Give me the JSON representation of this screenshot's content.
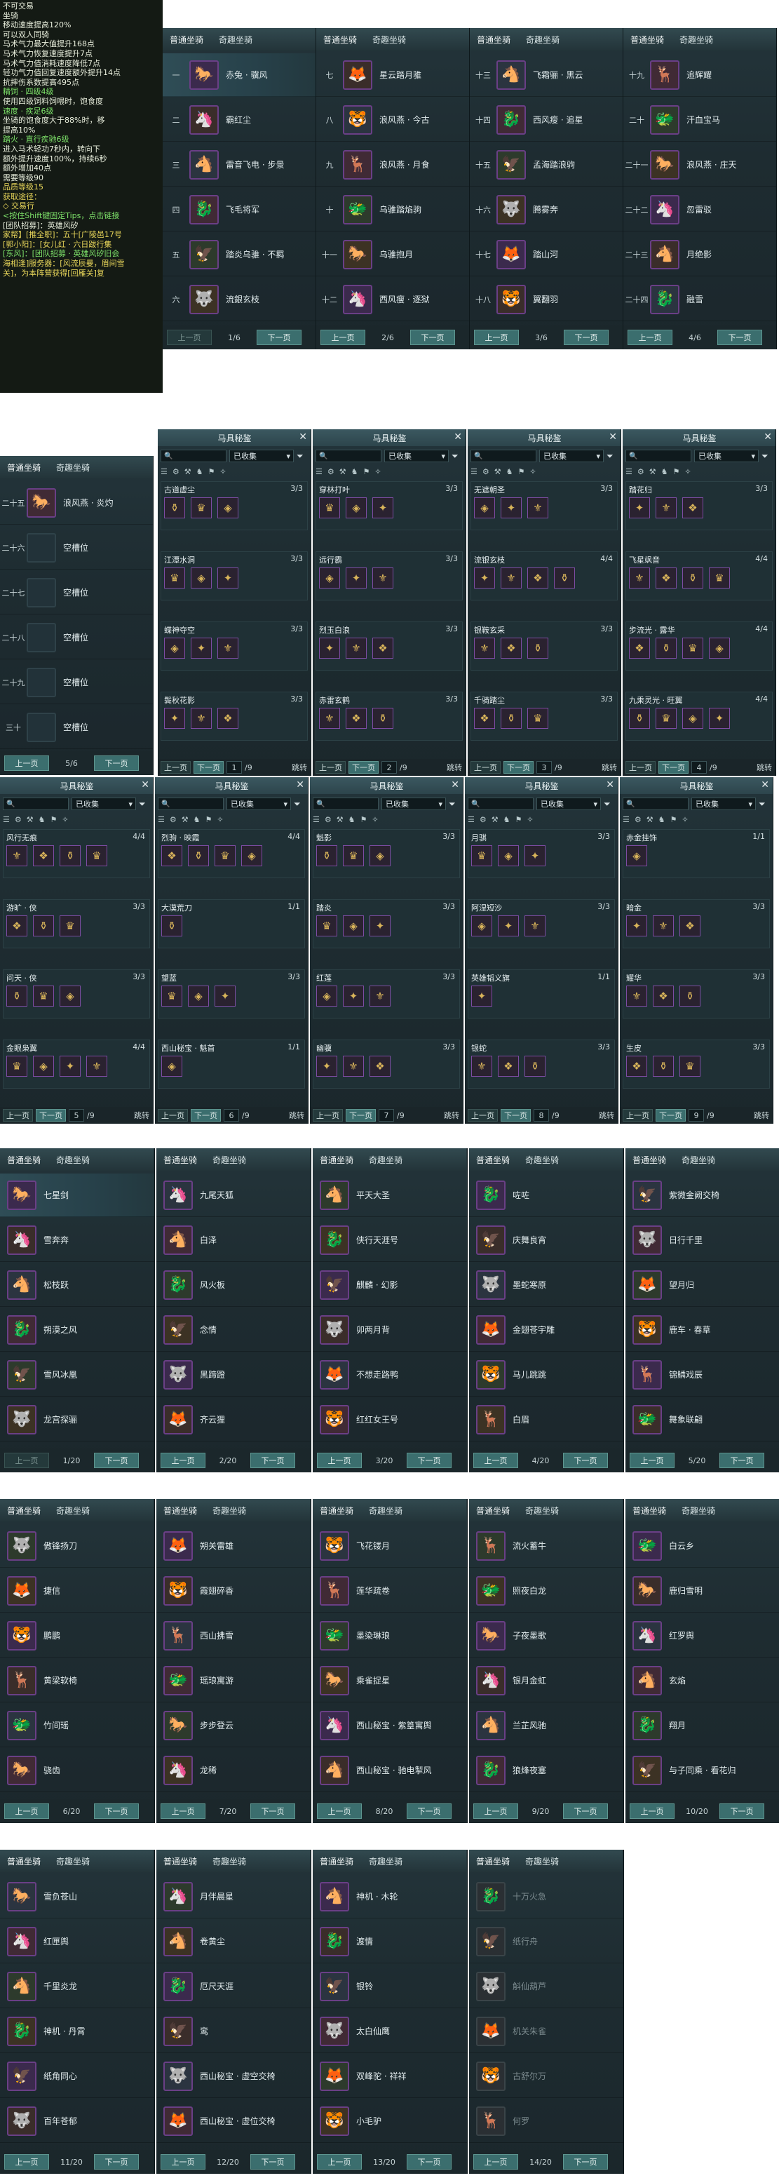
{
  "tooltip": {
    "lines": [
      {
        "t": "不可交易",
        "c": "#e8eedc"
      },
      {
        "t": "坐骑",
        "c": "#e8eedc"
      },
      {
        "t": "移动速度提高120%",
        "c": "#e8eedc"
      },
      {
        "t": "可以双人同骑",
        "c": "#e8eedc"
      },
      {
        "t": "马术气力最大值提升168点",
        "c": "#e8eedc"
      },
      {
        "t": "马术气力恢复速度提升7点",
        "c": "#e8eedc"
      },
      {
        "t": "马术气力值消耗速度降低7点",
        "c": "#e8eedc"
      },
      {
        "t": "轻功气力值回复速度额外提升14点",
        "c": "#e8eedc"
      },
      {
        "t": "抗摔伤系数提高495点",
        "c": "#e8eedc"
      },
      {
        "t": "精饲 · 四级4级",
        "c": "#7ee36a"
      },
      {
        "t": "使用四级饲料饲喂时，饱食度",
        "c": "#e8eedc"
      },
      {
        "t": "速度 · 疾足6级",
        "c": "#7ee36a"
      },
      {
        "t": "坐骑的饱食度大于88%时，移",
        "c": "#e8eedc"
      },
      {
        "t": "提高10%",
        "c": "#e8eedc"
      },
      {
        "t": "踏火 · 直行疾驰6级",
        "c": "#7ee36a"
      },
      {
        "t": "进入马术轻功7秒内，转向下",
        "c": "#e8eedc"
      },
      {
        "t": "额外提升速度100%，持续6秒",
        "c": "#e8eedc"
      },
      {
        "t": "额外增加40点",
        "c": "#e8eedc"
      },
      {
        "t": "需要等级90",
        "c": "#e8eedc"
      },
      {
        "t": "品质等级15",
        "c": "#e8d65a"
      },
      {
        "t": "获取途径：",
        "c": "#e8d65a"
      },
      {
        "t": "◇ 交易行",
        "c": "#e8d65a"
      },
      {
        "t": "",
        "c": "#e8eedc"
      },
      {
        "t": "<按住Shift键固定Tips，点击链接",
        "c": "#7ee36a"
      },
      {
        "t": "[团队招募]：英雄风矽",
        "c": "#e8eedc"
      },
      {
        "t": "家帮】[推全职]：五十[广陵邑17号",
        "c": "#e8d65a"
      },
      {
        "t": "[郭小阳]：[女儿红 · 六日跋行集",
        "c": "#e8d65a"
      },
      {
        "t": "[东风]：[团队招募 · 英雄风矽旧会",
        "c": "#7ee36a"
      },
      {
        "t": "",
        "c": "#e8eedc"
      },
      {
        "t": "海相逢]服务器：[风流辰曼，眉间雪",
        "c": "#e8d65a"
      },
      {
        "t": "关]，为本阵营获得[回雁关]复",
        "c": "#e8d65a"
      }
    ]
  },
  "tabs": {
    "normal": "普通坐骑",
    "odd": "奇趣坐骑"
  },
  "pager": {
    "prev": "上一页",
    "next": "下一页",
    "jump": "跳转"
  },
  "mount_pages_top": [
    {
      "page": "1/6",
      "rows": [
        {
          "n": "一",
          "name": "赤兔 · 骥风"
        },
        {
          "n": "二",
          "name": "霸红尘"
        },
        {
          "n": "三",
          "name": "雷音飞电 · 步景"
        },
        {
          "n": "四",
          "name": "飞毛将军"
        },
        {
          "n": "五",
          "name": "踏炎乌骓 · 不羁"
        },
        {
          "n": "六",
          "name": "流銀玄枝"
        }
      ]
    },
    {
      "page": "2/6",
      "rows": [
        {
          "n": "七",
          "name": "星云踏月骓"
        },
        {
          "n": "八",
          "name": "浪风燕 · 今古"
        },
        {
          "n": "九",
          "name": "浪风燕 · 月食"
        },
        {
          "n": "十",
          "name": "乌骓踏焰驹"
        },
        {
          "n": "十一",
          "name": "乌骓抱月"
        },
        {
          "n": "十二",
          "name": "西风瘦 · 逐狱"
        }
      ]
    },
    {
      "page": "3/6",
      "rows": [
        {
          "n": "十三",
          "name": "飞霜骊 · 黑云"
        },
        {
          "n": "十四",
          "name": "西风瘦 · 追星"
        },
        {
          "n": "十五",
          "name": "孟海踏浪驹"
        },
        {
          "n": "十六",
          "name": "腾雾奔"
        },
        {
          "n": "十七",
          "name": "踏山河"
        },
        {
          "n": "十八",
          "name": "翼翻羽"
        }
      ]
    },
    {
      "page": "4/6",
      "rows": [
        {
          "n": "十九",
          "name": "追辉耀"
        },
        {
          "n": "二十",
          "name": "汗血宝马"
        },
        {
          "n": "二十一",
          "name": "浪风燕 · 庄天"
        },
        {
          "n": "二十二",
          "name": "忽雷驳"
        },
        {
          "n": "二十三",
          "name": "月绝影"
        },
        {
          "n": "二十四",
          "name": "融雪"
        }
      ]
    }
  ],
  "mount_page5": {
    "page": "5/6",
    "rows": [
      {
        "n": "二十五",
        "name": "浪风燕 · 炎灼"
      },
      {
        "n": "二十六",
        "name": "空槽位"
      },
      {
        "n": "二十七",
        "name": "空槽位"
      },
      {
        "n": "二十八",
        "name": "空槽位"
      },
      {
        "n": "二十九",
        "name": "空槽位"
      },
      {
        "n": "三十",
        "name": "空槽位"
      }
    ]
  },
  "harness": {
    "title": "马具秘鉴",
    "filter": "已收集",
    "pages": [
      {
        "pg": "1",
        "of": "/9",
        "sets": [
          {
            "name": "古道虚尘",
            "count": "3/3"
          },
          {
            "name": "江潭水洞",
            "count": "3/3"
          },
          {
            "name": "蝶神夺空",
            "count": "3/3"
          },
          {
            "name": "鬓秋花影",
            "count": "3/3"
          }
        ]
      },
      {
        "pg": "2",
        "of": "/9",
        "sets": [
          {
            "name": "穿林打叶",
            "count": "3/3"
          },
          {
            "name": "远行霸",
            "count": "3/3"
          },
          {
            "name": "烈玉白浪",
            "count": "3/3"
          },
          {
            "name": "赤雷玄鹤",
            "count": "3/3"
          }
        ]
      },
      {
        "pg": "3",
        "of": "/9",
        "sets": [
          {
            "name": "无遮朝圣",
            "count": "3/3"
          },
          {
            "name": "流银玄枝",
            "count": "4/4"
          },
          {
            "name": "银鞍玄采",
            "count": "3/3"
          },
          {
            "name": "千骑踏尘",
            "count": "3/3"
          }
        ]
      },
      {
        "pg": "4",
        "of": "/9",
        "sets": [
          {
            "name": "踏花归",
            "count": "3/3"
          },
          {
            "name": "飞星飒音",
            "count": "4/4"
          },
          {
            "name": "步流光 · 露华",
            "count": "4/4"
          },
          {
            "name": "九乘灵光 · 旺翼",
            "count": "4/4"
          }
        ]
      },
      {
        "pg": "5",
        "of": "/9",
        "sets": [
          {
            "name": "风行无痕",
            "count": "4/4"
          },
          {
            "name": "游旷 · 侠",
            "count": "3/3"
          },
          {
            "name": "问天 · 侠",
            "count": "3/3"
          },
          {
            "name": "金眼枭翼",
            "count": "4/4"
          }
        ]
      },
      {
        "pg": "6",
        "of": "/9",
        "sets": [
          {
            "name": "烈驹 · 映霞",
            "count": "4/4"
          },
          {
            "name": "大漠荒刀",
            "count": "1/1"
          },
          {
            "name": "望蓝",
            "count": "3/3"
          },
          {
            "name": "西山秘宝 · 魁首",
            "count": "1/1"
          }
        ]
      },
      {
        "pg": "7",
        "of": "/9",
        "sets": [
          {
            "name": "魁影",
            "count": "3/3"
          },
          {
            "name": "踏炎",
            "count": "3/3"
          },
          {
            "name": "红莲",
            "count": "3/3"
          },
          {
            "name": "幽骥",
            "count": "3/3"
          }
        ]
      },
      {
        "pg": "8",
        "of": "/9",
        "sets": [
          {
            "name": "月骐",
            "count": "3/3"
          },
          {
            "name": "阿涅短沙",
            "count": "3/3"
          },
          {
            "name": "英雄韬义旗",
            "count": "1/1"
          },
          {
            "name": "银蛇",
            "count": "3/3"
          }
        ]
      },
      {
        "pg": "9",
        "of": "/9",
        "sets": [
          {
            "name": "赤金挂饰",
            "count": "1/1"
          },
          {
            "name": "暗金",
            "count": "3/3"
          },
          {
            "name": "耀华",
            "count": "3/3"
          },
          {
            "name": "生皮",
            "count": "3/3"
          }
        ]
      }
    ]
  },
  "odd_pages": [
    {
      "page": "1/20",
      "items": [
        "七星剑",
        "雪奔奔",
        "松枝跃",
        "朔漠之风",
        "雪风冰凰",
        "龙宫探骊"
      ]
    },
    {
      "page": "2/20",
      "items": [
        "九尾天狐",
        "白泽",
        "风火板",
        "念情",
        "黑蹄蹬",
        "齐云狸"
      ]
    },
    {
      "page": "3/20",
      "items": [
        "平天大圣",
        "侠行天涯号",
        "麒麟 · 幻影",
        "卯两月背",
        "不想走路鸭",
        "红红女王号"
      ]
    },
    {
      "page": "4/20",
      "items": [
        "咗咗",
        "庆舞良宵",
        "墨蛇寒原",
        "金翅苍宇雕",
        "马儿跳跳",
        "白眉"
      ]
    },
    {
      "page": "5/20",
      "items": [
        "紫微金阙交椅",
        "日行千里",
        "望月归",
        "鹿车 · 春草",
        "锦鳞戏辰",
        "舞象联翩"
      ]
    },
    {
      "page": "6/20",
      "items": [
        "傲锋扬刀",
        "捷信",
        "鹏鹏",
        "黄梁软椅",
        "竹间瑶",
        "骁齿"
      ]
    },
    {
      "page": "7/20",
      "items": [
        "朔关雷雄",
        "霞翅碎香",
        "西山拂雪",
        "瑶琅寓游",
        "步步登云",
        "龙稀"
      ]
    },
    {
      "page": "8/20",
      "items": [
        "飞花镂月",
        "莲华疏卷",
        "墨染琳琅",
        "乘雀捉星",
        "西山秘宝 · 紫篁寓舆",
        "西山秘宝 · 驰电掣风"
      ]
    },
    {
      "page": "9/20",
      "items": [
        "流火蓄牛",
        "照夜白龙",
        "子夜墨歌",
        "银月金虹",
        "兰芷风驰",
        "狼烽夜塞"
      ]
    },
    {
      "page": "10/20",
      "items": [
        "白云乡",
        "鹿归雪明",
        "红罗舆",
        "玄焰",
        "翔月",
        "与子同乘 · 看花归"
      ]
    },
    {
      "page": "11/20",
      "items": [
        "雪负苍山",
        "红匣舆",
        "千里炎龙",
        "神机 · 丹霄",
        "纸角同心",
        "百年苍郁"
      ]
    },
    {
      "page": "12/20",
      "items": [
        "月伴晨星",
        "卷黄尘",
        "厄尺天涯",
        "鸾",
        "西山秘宝 · 虚空交椅",
        "西山秘宝 · 虚位交椅"
      ]
    },
    {
      "page": "13/20",
      "items": [
        "神机 · 木轮",
        "渡情",
        "银铃",
        "太白仙鹰",
        "双峰驼 · 祥祥",
        "小毛驴"
      ]
    },
    {
      "page": "14/20",
      "items": [
        "十万火急",
        "纸行舟",
        "斛仙葫芦",
        "机关朱雀",
        "古舒尔万",
        "何罗"
      ]
    }
  ]
}
